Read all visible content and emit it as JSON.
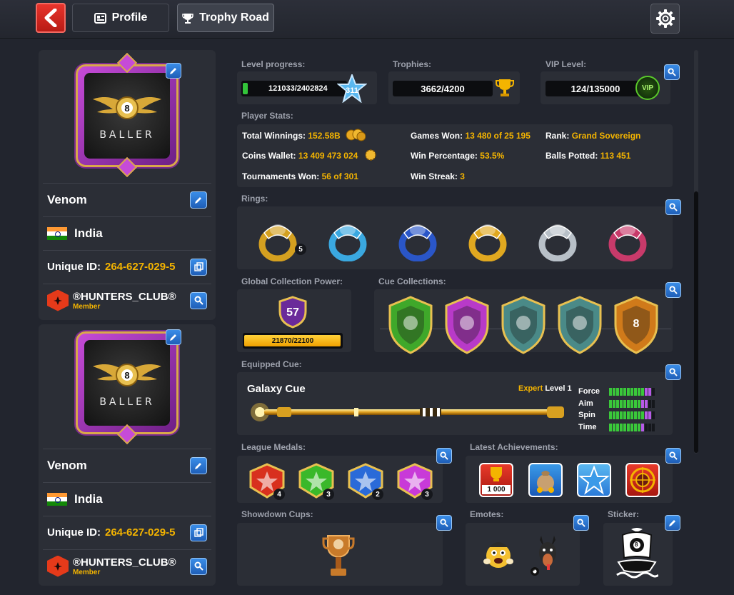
{
  "topbar": {
    "profile_tab": "Profile",
    "trophy_tab": "Trophy Road",
    "icons": [
      "back-arrow-icon",
      "profile-card-icon",
      "trophy-icon",
      "gear-icon"
    ]
  },
  "player_card": {
    "badge_text": "BALLER",
    "badge_number": "8",
    "name": "Venom",
    "country": "India",
    "uid_label": "Unique ID:",
    "uid_value": "264-627-029-5",
    "club_name": "®HUNTERS_CLUB®",
    "club_role": "Member"
  },
  "level": {
    "label": "Level progress:",
    "value": "121033/2402824",
    "level": "311",
    "progress": 0.05
  },
  "trophies": {
    "label": "Trophies:",
    "value": "3662/4200"
  },
  "vip": {
    "label": "VIP Level:",
    "value": "124/135000",
    "badge": "VIP"
  },
  "stats": {
    "label": "Player Stats:",
    "total_winnings_label": "Total Winnings:",
    "total_winnings": "152.58B",
    "games_won_label": "Games Won:",
    "games_won": "13 480 of 25 195",
    "rank_label": "Rank:",
    "rank": "Grand Sovereign",
    "coins_label": "Coins Wallet:",
    "coins": "13 409 473 024",
    "win_pct_label": "Win Percentage:",
    "win_pct": "53.5%",
    "balls_label": "Balls Potted:",
    "balls": "113 451",
    "tourn_label": "Tournaments Won:",
    "tourn": "56 of 301",
    "streak_label": "Win Streak:",
    "streak": "3"
  },
  "rings": {
    "label": "Rings:",
    "first_count": "5",
    "colors": [
      "#d4a020",
      "#3aa8e0",
      "#2a56c8",
      "#e0a820",
      "#b8c0c8",
      "#c83a6a"
    ]
  },
  "collection_power": {
    "label": "Global Collection Power:",
    "level": "57",
    "value": "21870/22100",
    "progress": 0.99
  },
  "cue_collections": {
    "label": "Cue Collections:",
    "colors": [
      "#3fa82a",
      "#b83ac8",
      "#4a8a88",
      "#4a8a88",
      "#d07a1a"
    ],
    "last_badge_number": "8"
  },
  "equipped_cue": {
    "label": "Equipped Cue:",
    "name": "Galaxy Cue",
    "tier": "Expert",
    "level": "Level 1",
    "attrs": [
      {
        "name": "Force",
        "green": 10,
        "purple": 2
      },
      {
        "name": "Aim",
        "green": 9,
        "purple": 2
      },
      {
        "name": "Spin",
        "green": 10,
        "purple": 2
      },
      {
        "name": "Time",
        "green": 9,
        "purple": 1
      }
    ]
  },
  "league_medals": {
    "label": "League Medals:",
    "medals": [
      {
        "color": "#d8301e",
        "count": "4"
      },
      {
        "color": "#3ab82a",
        "count": "3"
      },
      {
        "color": "#2a6ad8",
        "count": "2"
      },
      {
        "color": "#c83ad8",
        "count": "3"
      }
    ]
  },
  "achievements": {
    "label": "Latest Achievements:",
    "first_text": "1 000"
  },
  "showdown": {
    "label": "Showdown Cups:"
  },
  "emotes": {
    "label": "Emotes:",
    "ball_number": "8"
  },
  "sticker": {
    "label": "Sticker:",
    "ball_number": "8"
  }
}
